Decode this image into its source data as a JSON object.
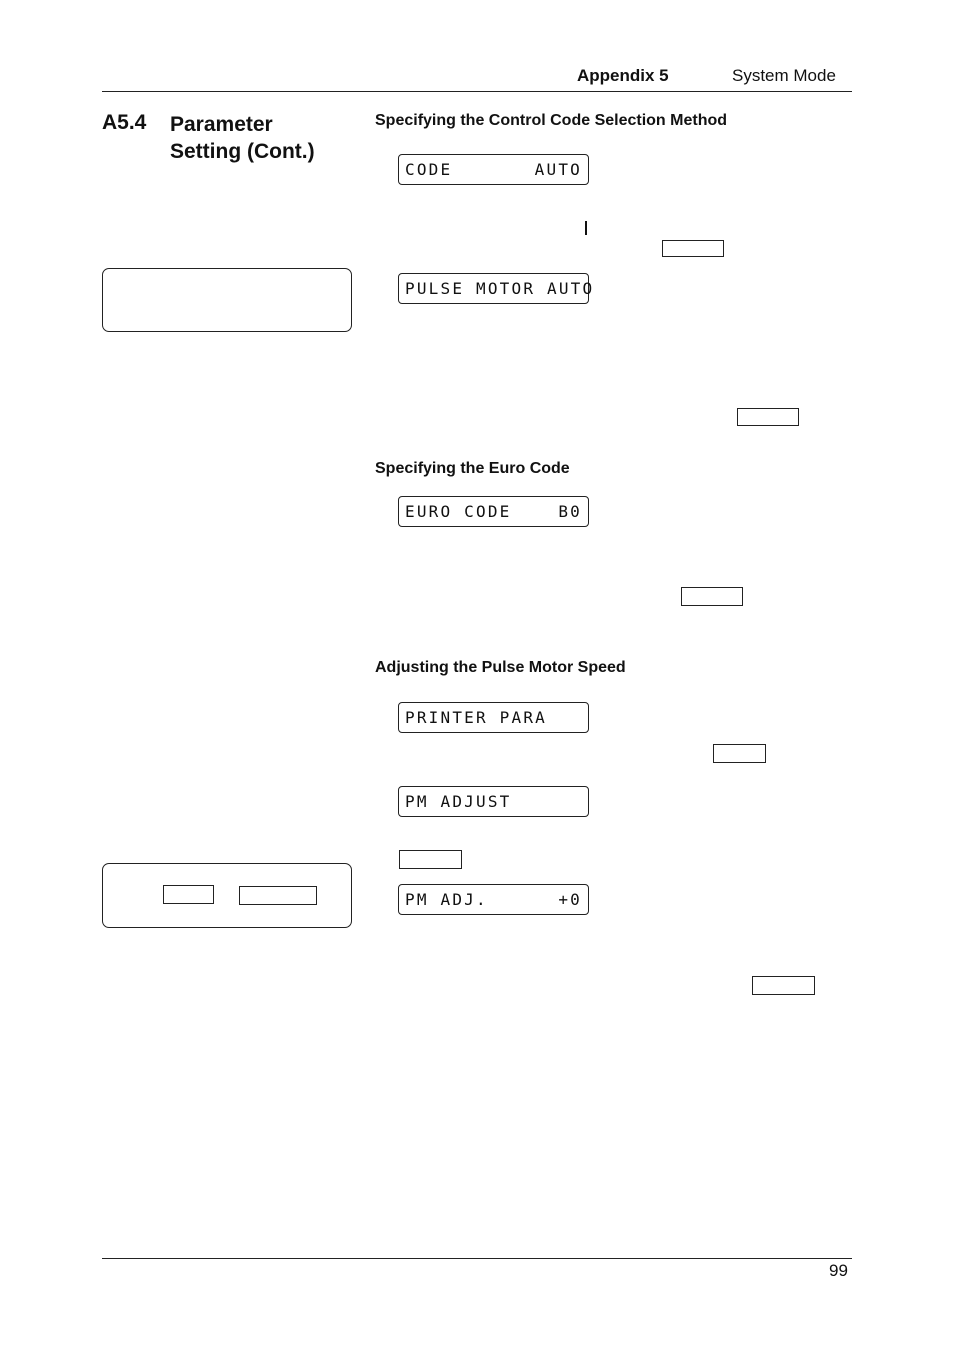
{
  "header": {
    "appendix": "Appendix 5",
    "chapter": "System Mode"
  },
  "section": {
    "number": "A5.4",
    "title_line1": "Parameter",
    "title_line2": "Setting (Cont.)"
  },
  "subsections": [
    {
      "heading": "Specifying the Control Code Selection Method",
      "displays": [
        {
          "left": "CODE",
          "right": "AUTO"
        },
        {
          "left": "PULSE MOTOR AUTO",
          "right": ""
        }
      ]
    },
    {
      "heading": "Specifying the Euro Code",
      "displays": [
        {
          "left": "EURO CODE",
          "right": "B0"
        }
      ]
    },
    {
      "heading": "Adjusting the Pulse Motor Speed",
      "displays": [
        {
          "left": "PRINTER PARA",
          "right": ""
        },
        {
          "left": "PM ADJUST",
          "right": ""
        },
        {
          "left": "PM ADJ.",
          "right": "+0"
        }
      ]
    }
  ],
  "footer": {
    "page_number": "99"
  }
}
